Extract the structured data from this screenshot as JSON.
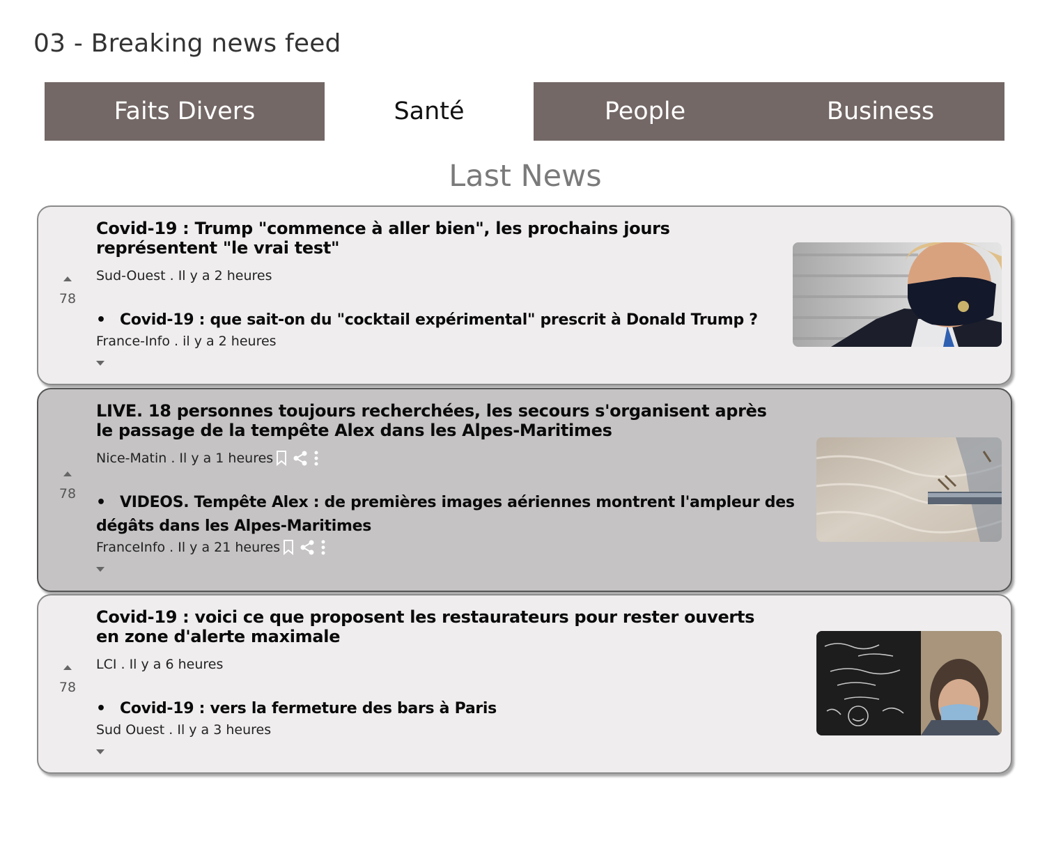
{
  "page": {
    "title": "03 - Breaking news feed"
  },
  "tabs": [
    {
      "label": "Faits Divers",
      "active": false
    },
    {
      "label": "Santé",
      "active": true
    },
    {
      "label": "People",
      "active": false
    },
    {
      "label": "Business",
      "active": false
    }
  ],
  "section_title": "Last News",
  "colors": {
    "tab_background": "#736866",
    "card_background": "#efedee",
    "card_highlight_background": "#c5c3c4"
  },
  "articles": [
    {
      "headline_line1": "Covid-19 : Trump \"commence à aller bien\", les prochains jours",
      "headline_line2": "représentent \"le vrai test\"",
      "meta": "Sud-Ouest . Il y a 2 heures",
      "votes": "78",
      "related_headline": "Covid-19 : que sait-on du \"cocktail expérimental\" prescrit à Donald Trump ?",
      "related_meta": "France-Info . il y a 2 heures",
      "highlighted": false,
      "thumbnail": "masked-man-photo"
    },
    {
      "headline_line1": "LIVE. 18 personnes toujours recherchées, les secours s'organisent après",
      "headline_line2": "le passage de la tempête Alex dans les Alpes-Maritimes",
      "meta": "Nice-Matin . Il y a 1 heures",
      "votes": "78",
      "related_headline_line1": "VIDEOS. Tempête Alex : de premières images aériennes montrent l'ampleur des",
      "related_headline_line2": "dégâts dans les Alpes-Maritimes",
      "related_meta": "FranceInfo . Il y a 21 heures",
      "highlighted": true,
      "actions": [
        "bookmark-icon",
        "share-icon",
        "more-icon"
      ],
      "thumbnail": "aerial-flood-photo"
    },
    {
      "headline_line1": "Covid-19 : voici ce que proposent les restaurateurs pour rester ouverts",
      "headline_line2": "en zone d'alerte maximale",
      "meta": "LCI . Il y a 6 heures",
      "votes": "78",
      "related_headline": "Covid-19 : vers la fermeture des bars à Paris",
      "related_meta": "Sud Ouest . Il y a 3 heures",
      "highlighted": false,
      "thumbnail": "restaurant-chalkboard-photo"
    }
  ]
}
